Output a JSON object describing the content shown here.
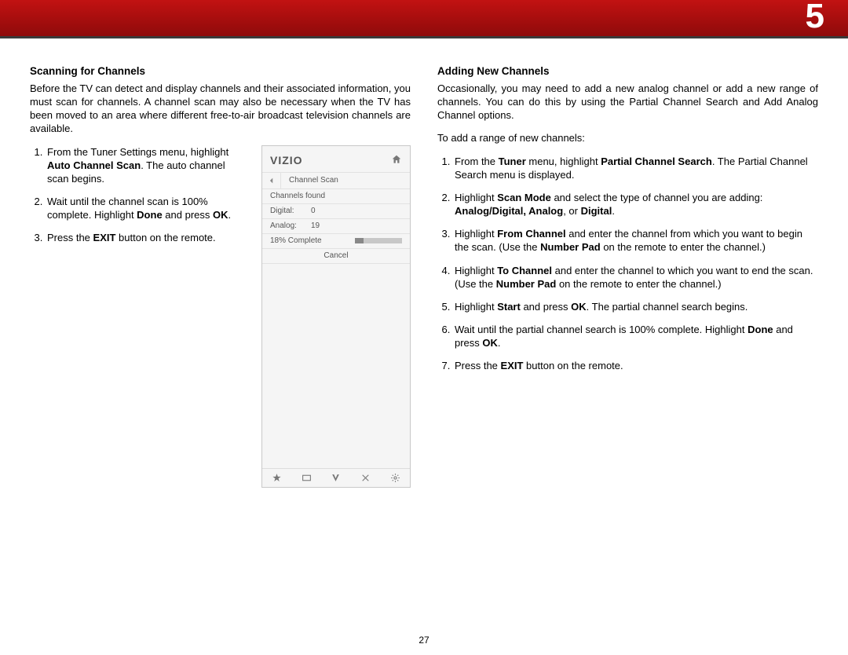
{
  "chapter": "5",
  "page_number": "27",
  "left": {
    "title": "Scanning for Channels",
    "intro": "Before the TV can detect and display channels and their associated information, you must scan for channels. A channel scan may also be necessary when the TV has been moved to an area where different free-to-air broadcast television channels are available.",
    "steps": {
      "s1a": "From the Tuner Settings menu, highlight ",
      "s1b": "Auto Channel Scan",
      "s1c": ". The auto channel scan begins.",
      "s2a": "Wait until the channel scan is 100% complete. Highlight ",
      "s2b": "Done",
      "s2c": " and press ",
      "s2d": "OK",
      "s2e": ".",
      "s3a": "Press the ",
      "s3b": "EXIT",
      "s3c": " button on the remote."
    }
  },
  "menu": {
    "brand": "VIZIO",
    "title": "Channel Scan",
    "found_label": "Channels found",
    "digital_label": "Digital:",
    "digital_value": "0",
    "analog_label": "Analog:",
    "analog_value": "19",
    "progress_label": "18% Complete",
    "cancel": "Cancel"
  },
  "right": {
    "title": "Adding New Channels",
    "intro": "Occasionally, you may need to add a new analog channel or add a new range of channels. You can do this by using the Partial Channel Search and Add Analog Channel options.",
    "lead": "To add a range of new channels:",
    "steps": {
      "s1a": "From the ",
      "s1b": "Tuner",
      "s1c": " menu, highlight ",
      "s1d": "Partial Channel Search",
      "s1e": ". The Partial Channel Search menu is displayed.",
      "s2a": "Highlight ",
      "s2b": "Scan Mode",
      "s2c": " and select the type of channel you are adding: ",
      "s2d": "Analog/Digital, Analog",
      "s2e": ", or ",
      "s2f": "Digital",
      "s2g": ".",
      "s3a": "Highlight ",
      "s3b": "From Channel",
      "s3c": " and enter the channel from which you want to begin the scan. (Use the ",
      "s3d": "Number Pad",
      "s3e": " on the remote to enter the channel.)",
      "s4a": "Highlight ",
      "s4b": "To Channel",
      "s4c": " and enter the channel to which you want to end the scan. (Use the ",
      "s4d": "Number Pad",
      "s4e": " on the remote to enter the channel.)",
      "s5a": "Highlight ",
      "s5b": "Start",
      "s5c": " and press ",
      "s5d": "OK",
      "s5e": ". The partial channel search begins.",
      "s6a": "Wait until the partial channel search is 100% complete. Highlight ",
      "s6b": "Done",
      "s6c": " and press ",
      "s6d": "OK",
      "s6e": ".",
      "s7a": "Press the ",
      "s7b": "EXIT",
      "s7c": " button on the remote."
    }
  }
}
